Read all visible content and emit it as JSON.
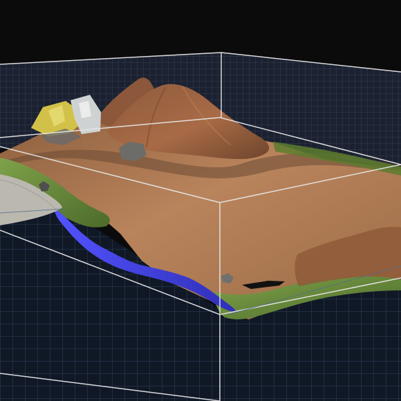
{
  "viewer": {
    "mode": "3d-model-viewport",
    "background_color": "#0b0b0c",
    "grid": true,
    "grid_color": "#4b6a8a",
    "bounding_box_color": "#e6e6e6",
    "water_color": "#3d3fd6",
    "terrain_colors": {
      "soil": "#b7825a",
      "soil_dark": "#7a4f33",
      "grass": "#6d8f3b",
      "concrete": "#bdbbb3",
      "equipment": "#d8c14a"
    }
  }
}
